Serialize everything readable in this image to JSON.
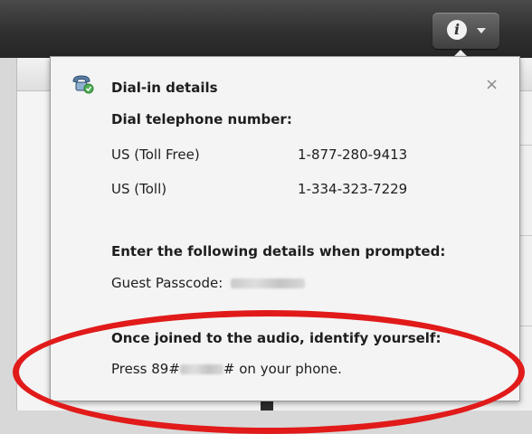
{
  "toolbar": {
    "info_icon_glyph": "i"
  },
  "popup": {
    "title": "Dial-in details",
    "close_glyph": "×",
    "dial_heading": "Dial telephone number:",
    "numbers": [
      {
        "label": "US (Toll Free)",
        "number": "1-877-280-9413"
      },
      {
        "label": "US (Toll)",
        "number": "1-334-323-7229"
      }
    ],
    "prompt_heading": "Enter the following details when prompted:",
    "passcode_label": "Guest Passcode:",
    "identify_heading": "Once joined to the audio, identify yourself:",
    "press_prefix": "Press 89#",
    "press_suffix": "# on your phone."
  },
  "colors": {
    "highlight": "#e11a1a",
    "topbar": "#2e2e2e"
  }
}
